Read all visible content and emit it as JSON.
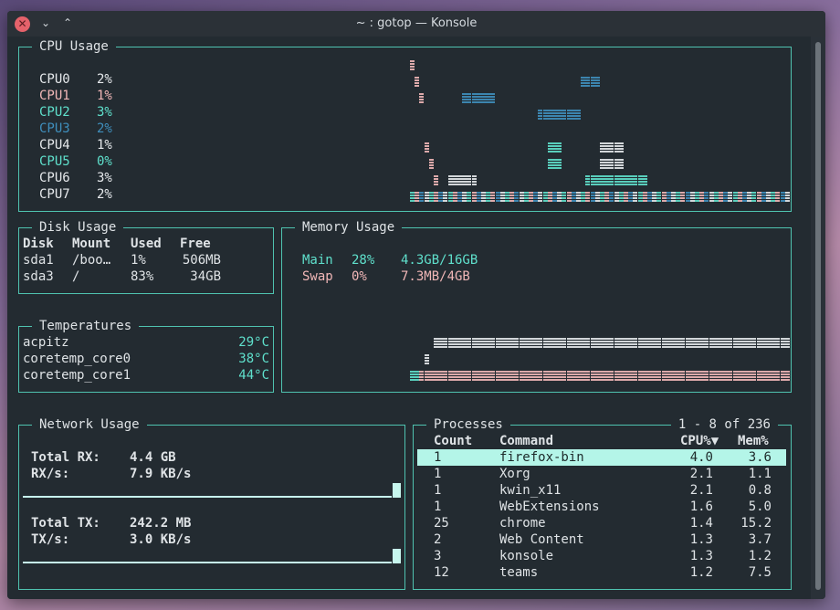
{
  "window": {
    "title": "~ : gotop — Konsole",
    "close_glyph": "✕",
    "minimize_glyph": "⌄",
    "maximize_glyph": "⌃"
  },
  "cpu": {
    "label": "CPU Usage",
    "cores": [
      {
        "name": "CPU0",
        "value": "2%",
        "color": "#e6e9ec"
      },
      {
        "name": "CPU1",
        "value": "1%",
        "color": "#f1b7b7"
      },
      {
        "name": "CPU2",
        "value": "3%",
        "color": "#5fe0cc"
      },
      {
        "name": "CPU3",
        "value": "2%",
        "color": "#3f8fbd"
      },
      {
        "name": "CPU4",
        "value": "1%",
        "color": "#e6e9ec"
      },
      {
        "name": "CPU5",
        "value": "0%",
        "color": "#5fe0cc"
      },
      {
        "name": "CPU6",
        "value": "3%",
        "color": "#e6e9ec"
      },
      {
        "name": "CPU7",
        "value": "2%",
        "color": "#e6e9ec"
      }
    ]
  },
  "disk": {
    "label": "Disk Usage",
    "headers": [
      "Disk",
      "Mount",
      "Used",
      "Free"
    ],
    "rows": [
      [
        "sda1",
        "/boo…",
        "1%",
        "506MB"
      ],
      [
        "sda3",
        "/",
        "83%",
        "34GB"
      ]
    ]
  },
  "memory": {
    "label": "Memory Usage",
    "rows": [
      {
        "name": "Main",
        "pct": "28%",
        "amount": "4.3GB/16GB",
        "color": "#5fe0cc"
      },
      {
        "name": "Swap",
        "pct": "0%",
        "amount": "7.3MB/4GB",
        "color": "#f1b7b7"
      }
    ]
  },
  "temps": {
    "label": "Temperatures",
    "rows": [
      {
        "name": "acpitz",
        "value": "29°C"
      },
      {
        "name": "coretemp_core0",
        "value": "38°C"
      },
      {
        "name": "coretemp_core1",
        "value": "44°C"
      }
    ]
  },
  "network": {
    "label": "Network Usage",
    "rx_total_label": "Total RX:",
    "rx_total": "4.4 GB",
    "rx_rate_label": "RX/s:",
    "rx_rate": "7.9 KB/s",
    "tx_total_label": "Total TX:",
    "tx_total": "242.2 MB",
    "tx_rate_label": "TX/s:",
    "tx_rate": "3.0 KB/s"
  },
  "processes": {
    "label": "Processes",
    "range": "1 - 8 of 236",
    "headers": {
      "count": "Count",
      "command": "Command",
      "cpu": "CPU%▼",
      "mem": "Mem%"
    },
    "rows": [
      [
        "1",
        "firefox-bin",
        "4.0",
        "3.6"
      ],
      [
        "1",
        "Xorg",
        "2.1",
        "1.1"
      ],
      [
        "1",
        "kwin_x11",
        "2.1",
        "0.8"
      ],
      [
        "1",
        "WebExtensions",
        "1.6",
        "5.0"
      ],
      [
        "25",
        "chrome",
        "1.4",
        "15.2"
      ],
      [
        "2",
        "Web Content",
        "1.3",
        "3.7"
      ],
      [
        "3",
        "konsole",
        "1.3",
        "1.2"
      ],
      [
        "12",
        "teams",
        "1.2",
        "7.5"
      ]
    ]
  }
}
